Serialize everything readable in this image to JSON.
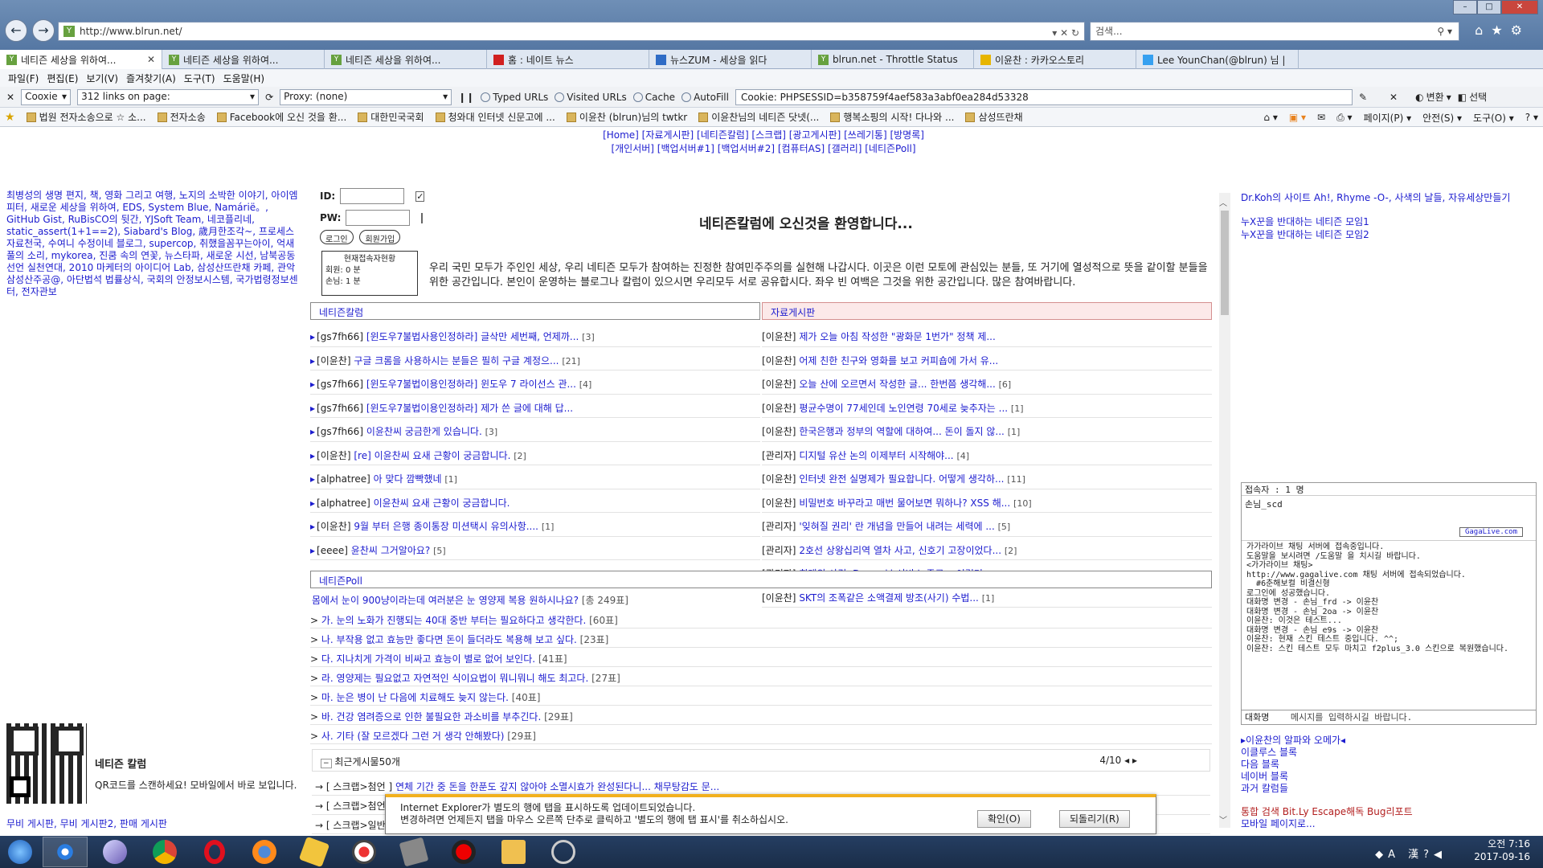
{
  "browser": {
    "url": "http://www.blrun.net/",
    "search_placeholder": "검색...",
    "tabs": [
      {
        "label": "네티즌 세상을 위하여...",
        "icon": "y",
        "active": true
      },
      {
        "label": "네티즌 세상을 위하여...",
        "icon": "y"
      },
      {
        "label": "네티즌 세상을 위하여...",
        "icon": "y"
      },
      {
        "label": "홈 : 네이트 뉴스",
        "icon": "red"
      },
      {
        "label": "뉴스ZUM - 세상을 읽다",
        "icon": "blue"
      },
      {
        "label": "blrun.net - Throttle Status",
        "icon": "y"
      },
      {
        "label": "이윤찬 : 카카오스토리",
        "icon": "ylw"
      },
      {
        "label": "Lee YounChan(@blrun) 님 |",
        "icon": "tw"
      }
    ],
    "menu": [
      "파일(F)",
      "편집(E)",
      "보기(V)",
      "즐겨찾기(A)",
      "도구(T)",
      "도움말(H)"
    ],
    "toolbar": {
      "coxie": "Cooxie",
      "links": "312 links on page:",
      "proxy": "Proxy: (none)",
      "typed_urls": "Typed URLs",
      "visited_urls": "Visited URLs",
      "cache": "Cache",
      "autofill": "AutoFill",
      "cookie": "Cookie: PHPSESSID=b358759f4aef583a3abf0ea284d53328",
      "translate": "변환",
      "select": "선택"
    },
    "favorites": [
      "법원 전자소송으로 ☆ 소...",
      "전자소송",
      "Facebook에 오신 것을 환...",
      "대한민국국회",
      "청와대 인터넷 신문고에 ...",
      "이윤찬 (blrun)님의 twtkr",
      "이윤찬님의 네티즌 닷넷(...",
      "행복소핑의 시작! 다나와 ...",
      "삼성뜨란채"
    ],
    "commands": [
      "페이지(P)",
      "안전(S)",
      "도구(O)"
    ]
  },
  "nav": {
    "line1": "[Home] [자료게시판] [네티즌칼럼] [스크랩] [광고게시판] [쓰레기통] [방명록]",
    "line2": "[개인서버] [백업서버#1] [백업서버#2] [컴퓨터AS] [갤러리] [네티즌Poll]"
  },
  "left_links": "최병성의 생명 편지, 책, 영화 그리고 여행, 노지의 소박한 이야기, 아이엠피터, 새로운 세상을 위하여, EDS, System Blue, Namárië。, GitHub Gist, RuBisCO의 뒷간, YJSoft Team, 네코플리네, static_assert(1+1==2), Siabard's Blog, 歲月한조각~, 프로세스 자료천국, 수여니 수정이네 블로그, supercop, 취했을꼼꾸는아이, 억새풀의 소리, mykorea, 진쿰 속의 연꽃, 뉴스타파, 새로운 시선, 남북공동선언 실천연대, 2010 마케터의 아이디어 Lab, 삼성산뜨란채 카페, 관악삼성산주공@, 아단법석 법률상식, 국회의 안정보시스템, 국가법령정보센터, 전자관보",
  "login": {
    "id_label": "ID:",
    "pw_label": "PW:",
    "login_btn": "로그인",
    "join_btn": "회원가입",
    "visitors_title": "현재접속자현황",
    "member_label": "회원:",
    "member_count": "0 분",
    "guest_label": "손님:",
    "guest_count": "1 분"
  },
  "welcome": "네티즌칼럼에 오신것을 환영합니다...",
  "intro": "우리 국민 모두가 주인인 세상, 우리 네티즌 모두가 참여하는 진정한 참여민주주의를 실현해 나갑시다. 이곳은 이런 모토에 관심있는 분들, 또 거기에 열성적으로 뜻을 같이할 분들을 위한 공간입니다. 본인이 운영하는 블로그나 칼럼이 있으시면 우리모두 서로 공유합시다. 좌우 빈 여백은 그것을 위한 공간입니다. 많은 참여바랍니다.",
  "column": {
    "title": "네티즌칼럼",
    "items": [
      {
        "who": "[gs7fh66]",
        "title": "[윈도우7불법사용인정하라] 글삭만 세번째, 언제까...",
        "count": "[3]"
      },
      {
        "who": "[이윤찬]",
        "title": "구글 크롬을 사용하시는 분들은 필히 구글 계정으...",
        "count": "[21]"
      },
      {
        "who": "[gs7fh66]",
        "title": "[윈도우7불법이용인정하라] 윈도우 7 라이선스 관...",
        "count": "[4]"
      },
      {
        "who": "[gs7fh66]",
        "title": "[윈도우7불법이용인정하라] 제가 쓴 글에 대해 답...",
        "count": ""
      },
      {
        "who": "[gs7fh66]",
        "title": "이윤찬씨 궁금한게 있습니다.",
        "count": "[3]"
      },
      {
        "who": "[이윤찬]",
        "title": "[re] 이윤찬씨 요새 근황이 궁금합니다.",
        "count": "[2]"
      },
      {
        "who": "[alphatree]",
        "title": "아 맞다 깜빡했네",
        "count": "[1]"
      },
      {
        "who": "[alphatree]",
        "title": "이윤찬씨 요새 근황이 궁금합니다.",
        "count": ""
      },
      {
        "who": "[이윤찬]",
        "title": "9월 부터 은행 종이통장 미션택시 유의사항....",
        "count": "[1]"
      },
      {
        "who": "[eeee]",
        "title": "윤찬씨 그거알아요?",
        "count": "[5]"
      }
    ]
  },
  "board": {
    "title": "자료게시판",
    "items": [
      {
        "who": "[이윤찬]",
        "title": "제가 오늘 아침 작성한 \"광화문 1번가\" 정책 제...",
        "count": ""
      },
      {
        "who": "[이윤찬]",
        "title": "어제 친한 친구와 영화를 보고 커피숍에 가서 유...",
        "count": ""
      },
      {
        "who": "[이윤찬]",
        "title": "오늘 산에 오르면서 작성한 글... 한번쯤 생각해...",
        "count": "[6]"
      },
      {
        "who": "[이윤찬]",
        "title": "평균수명이 77세인데 노인연령 70세로 늦추자는 ...",
        "count": "[1]"
      },
      {
        "who": "[이윤찬]",
        "title": "한국은행과 정부의 역할에 대하여... 돈이 돌지 않...",
        "count": "[1]"
      },
      {
        "who": "[관리자]",
        "title": "디지털 유산 논의 이제부터 시작해야...",
        "count": "[4]"
      },
      {
        "who": "[이윤찬]",
        "title": "인터넷 완전 실명제가 필요합니다. 어떻게 생각하...",
        "count": "[11]"
      },
      {
        "who": "[이윤찬]",
        "title": "비밀번호 바꾸라고 매번 물어보면 뭐하나? XSS 해...",
        "count": "[10]"
      },
      {
        "who": "[관리자]",
        "title": "'잊혀질 권리' 란 개념을 만들어 내려는 세력에 ...",
        "count": "[5]"
      },
      {
        "who": "[관리자]",
        "title": "2호선 상왕십리역 열차 사고, 신호기 고장이었다...",
        "count": "[2]"
      },
      {
        "who": "[관리자]",
        "title": "희대의 사건, Daum 뷰 서비스 종료... 이럴거...",
        "count": ""
      },
      {
        "who": "[이윤찬]",
        "title": "SKT의 조폭같은 소액결제 방조(사기) 수법...",
        "count": "[1]"
      }
    ]
  },
  "poll": {
    "title": "네티즌Poll",
    "question": "몸에서 눈이 900냥이라는데 여러분은 눈 영양제 복용 원하시나요?",
    "total": "[총 249표]",
    "options": [
      {
        "text": "가. 눈의 노화가 진행되는 40대 중반 부터는 필요하다고 생각한다.",
        "votes": "[60표]"
      },
      {
        "text": "나. 부작용 없고 효능만 좋다면 돈이 들더라도 복용해 보고 싶다.",
        "votes": "[23표]"
      },
      {
        "text": "다. 지나치게 가격이 비싸고 효능이 별로 없어 보인다.",
        "votes": "[41표]"
      },
      {
        "text": "라. 영양제는 필요없고 자연적인 식이요법이 뭐니뭐니 해도 최고다.",
        "votes": "[27표]"
      },
      {
        "text": "마. 눈은 병이 난 다음에 치료해도 늦지 않는다.",
        "votes": "[40표]"
      },
      {
        "text": "바. 건강 염려증으로 인한 불필요한 과소비를 부추긴다.",
        "votes": "[29표]"
      },
      {
        "text": "사. 기타 (잘 모르겠다 그런 거 생각 안해봤다)",
        "votes": "[29표]"
      }
    ]
  },
  "recent": {
    "title": "최근게시물50개",
    "page": "4/10",
    "items": [
      {
        "cat": "[ 스크랩>첨언 ]",
        "title": "연체 기간 중 돈을 한푼도 갚지 않아야 소멸시효가 완성된다니... 채무탕감도 문..."
      },
      {
        "cat": "[ 스크랩>첨언 ]",
        "title": ""
      },
      {
        "cat": "[ 스크랩>일반 ]",
        "title": ""
      }
    ]
  },
  "qr": {
    "title": "네티즌 칼럼",
    "desc": "QR코드를 스캔하세요! 모바일에서 바로 보입니다."
  },
  "mobile_links": "무비 게시판, 무비 게시판2, 판매 게시판",
  "right_top": {
    "line1": "Dr.Koh의 사이트 Ah!, Rhyme -O-, 사색의 날들, 자유세상만들기",
    "line2": "누X꾼을 반대하는 네티즌 모임1",
    "line3": "누X꾼을 반대하는 네티즌 모임2"
  },
  "chat": {
    "count": "접속자 : 1 명",
    "user": "손님_scd",
    "brand": "GagaLive.com",
    "log": "가가라이브 채팅 서버에 접속중입니다.\n도움말을 보시려면 /도움말 을 치시길 바랍니다.\n<가가라이브 채팅>\nhttp://www.gagalive.com 채팅 서버에 접속되었습니다.\n  #6춘해보컬 비결신형\n로그인에 성공했습니다.\n대화명 변경 - 손님_frd -> 이윤찬\n대화명 변경 - 손님_2oa -> 이윤찬\n이윤찬: 이것은 테스트...\n대화명 변경 - 손님_e9s -> 이윤찬\n이윤찬: 현재 스킨 테스트 중입니다. ^^;\n이윤찬: 스킨 테스트 모두 마치고 f2plus_3.0 스킨으로 복원했습니다.",
    "name_label": "대화명",
    "input_placeholder": "메시지를 입력하시길 바랍니다."
  },
  "right_bottom": {
    "l1": "▸이윤찬의 알파와 오메가◂",
    "l2": "이클루스 블록",
    "l3": "다음 블록",
    "l4": "네이버 블록",
    "l5": "과거 칼럼들",
    "l6": "통합 검색 Bit.Ly Escape해독 Bug리포트",
    "l7": "모바일 페이지로..."
  },
  "notify": {
    "line1": "Internet Explorer가 별도의 행에 탭을 표시하도록 업데이트되었습니다.",
    "line2": "변경하려면 언제든지 탭을 마우스 오른쪽 단추로 클릭하고 '별도의 행에 탭 표시'를 취소하십시오.",
    "ok": "확인(O)",
    "revert": "되돌리기(R)"
  },
  "taskbar": {
    "time": "오전 7:16",
    "date": "2017-09-16",
    "ime": "A 漢"
  }
}
